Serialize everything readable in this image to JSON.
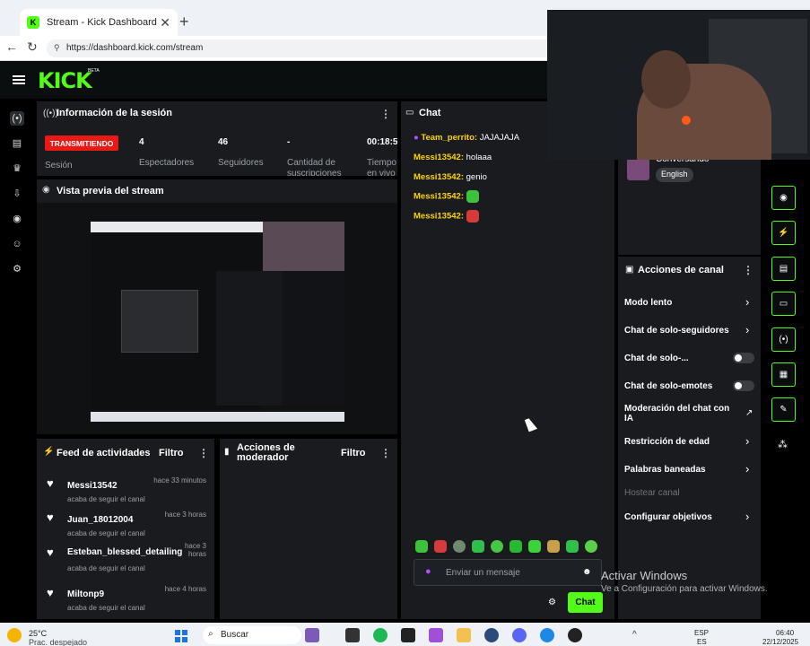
{
  "browser": {
    "tab_title": "Stream - Kick Dashboard",
    "url": "https://dashboard.kick.com/stream",
    "close": "✕",
    "new_tab": "+"
  },
  "app": {
    "logo": "KICK",
    "beta": "BETA",
    "accent": "#53fc18"
  },
  "session": {
    "title": "Información de la sesión",
    "status_badge": "TRANSMITIENDO",
    "status_label": "Sesión",
    "stats": [
      {
        "value": "4",
        "label": "Espectadores"
      },
      {
        "value": "46",
        "label": "Seguidores"
      },
      {
        "value": "-",
        "label": "Cantidad de suscripciones"
      },
      {
        "value": "00:18:5",
        "label": "Tiempo en vivo"
      }
    ]
  },
  "preview": {
    "title": "Vista previa del stream"
  },
  "feed": {
    "title": "Feed de actividades",
    "filter": "Filtro",
    "items": [
      {
        "user": "Messi13542",
        "time": "hace 33 minutos",
        "sub": "acaba de seguir el canal"
      },
      {
        "user": "Juan_18012004",
        "time": "hace 3 horas",
        "sub": "acaba de seguir el canal"
      },
      {
        "user": "Esteban_blessed_detailing",
        "time": "hace 3 horas",
        "sub": "acaba de seguir el canal"
      },
      {
        "user": "Miltonp9",
        "time": "hace 4 horas",
        "sub": "acaba de seguir el canal"
      }
    ]
  },
  "modactions": {
    "title": "Acciones de moderador",
    "filter": "Filtro"
  },
  "chat": {
    "title": "Chat",
    "messages": [
      {
        "user": "Team_perrito:",
        "text": "JAJAJAJA"
      },
      {
        "user": "Messi13542:",
        "text": "holaaa"
      },
      {
        "user": "Messi13542:",
        "text": "genio"
      },
      {
        "user": "Messi13542:",
        "text": ""
      },
      {
        "user": "Messi13542:",
        "text": ""
      }
    ],
    "placeholder": "Enviar un mensaje",
    "send": "Chat"
  },
  "stream_info": {
    "category": "Conversando",
    "language": "English"
  },
  "channel_actions": {
    "title": "Acciones de canal",
    "items": [
      {
        "label": "Modo lento"
      },
      {
        "label": "Chat de solo-seguidores"
      },
      {
        "label": "Chat de solo-..."
      },
      {
        "label": "Chat de solo-emotes"
      },
      {
        "label": "Moderación del chat con IA"
      },
      {
        "label": "Restricción de edad"
      },
      {
        "label": "Palabras baneadas"
      },
      {
        "label": "Hostear canal"
      },
      {
        "label": "Configurar objetivos"
      }
    ]
  },
  "windows": {
    "watermark_title": "Activar Windows",
    "watermark_sub": "Ve a Configuración para activar Windows.",
    "weather_temp": "25°C",
    "weather_text": "Prac. despejado",
    "search": "Buscar",
    "lang": "ESP",
    "lang2": "ES",
    "time": "06:40",
    "date": "22/12/2025"
  }
}
